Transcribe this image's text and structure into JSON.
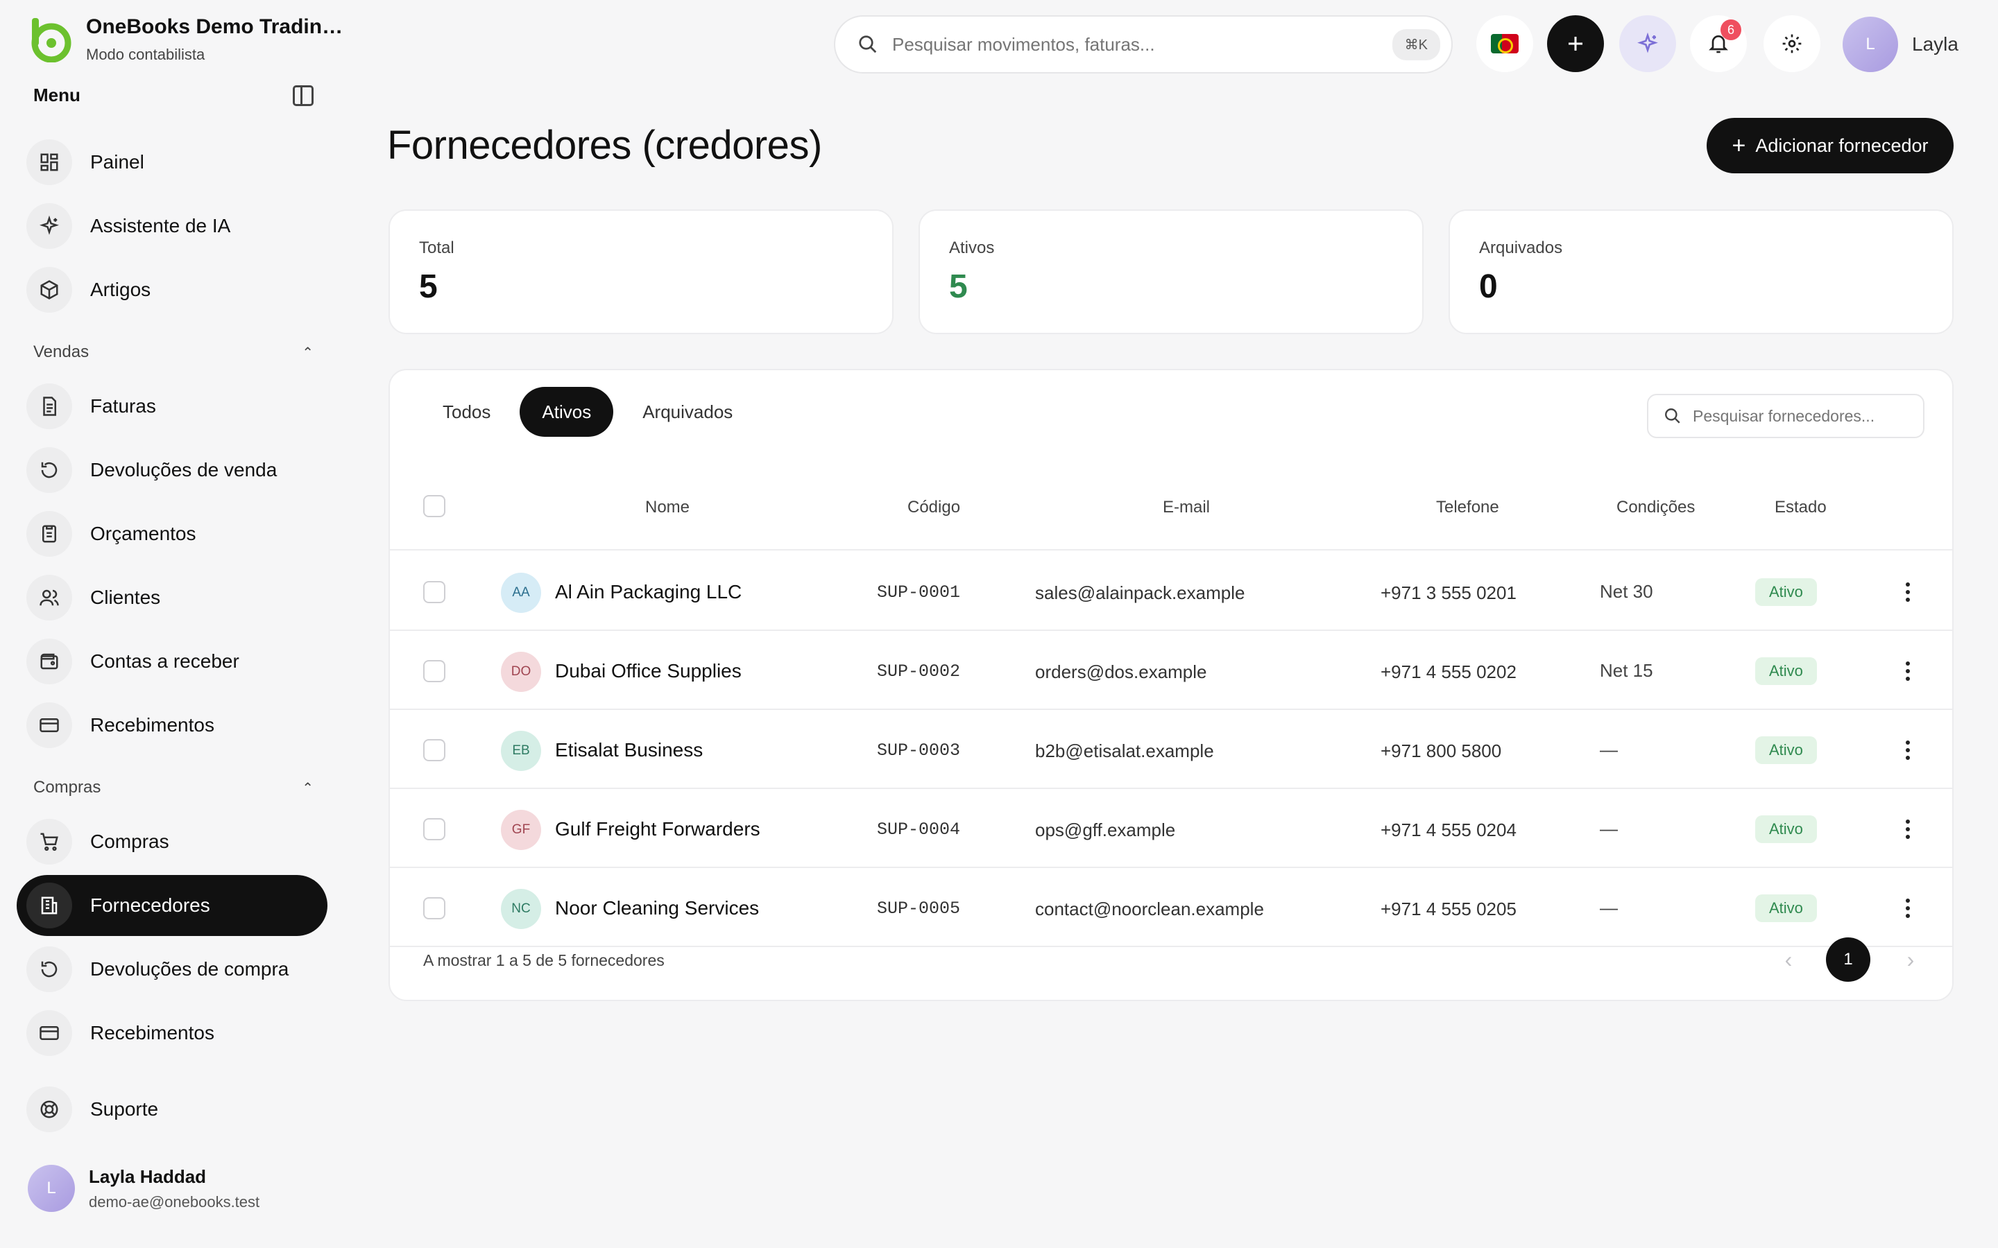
{
  "brand": {
    "name": "OneBooks Demo Tradin…",
    "subtitle": "Modo contabilista"
  },
  "menu": {
    "title": "Menu"
  },
  "sidebar": {
    "top_items": [
      {
        "label": "Painel",
        "icon": "dashboard-icon"
      },
      {
        "label": "Assistente de IA",
        "icon": "sparkles-icon"
      },
      {
        "label": "Artigos",
        "icon": "package-icon"
      }
    ],
    "sales": {
      "title": "Vendas",
      "items": [
        {
          "label": "Faturas",
          "icon": "invoice-icon"
        },
        {
          "label": "Devoluções de venda",
          "icon": "return-icon"
        },
        {
          "label": "Orçamentos",
          "icon": "quote-icon"
        },
        {
          "label": "Clientes",
          "icon": "users-icon"
        },
        {
          "label": "Contas a receber",
          "icon": "wallet-icon"
        },
        {
          "label": "Recebimentos",
          "icon": "card-icon"
        }
      ]
    },
    "purchases": {
      "title": "Compras",
      "items": [
        {
          "label": "Compras",
          "icon": "cart-icon"
        },
        {
          "label": "Fornecedores",
          "icon": "building-icon",
          "active": true
        },
        {
          "label": "Devoluções de compra",
          "icon": "return-icon"
        },
        {
          "label": "Recebimentos",
          "icon": "card-icon"
        }
      ]
    },
    "support": {
      "label": "Suporte",
      "icon": "lifebuoy-icon"
    }
  },
  "user": {
    "initial": "L",
    "name": "Layla Haddad",
    "email": "demo-ae@onebooks.test",
    "short_name": "Layla"
  },
  "topbar": {
    "search_placeholder": "Pesquisar movimentos, faturas...",
    "shortcut": "⌘K",
    "notifications_count": "6"
  },
  "page": {
    "title": "Fornecedores (credores)",
    "add_button": "Adicionar fornecedor"
  },
  "stats": {
    "total": {
      "label": "Total",
      "value": "5"
    },
    "active": {
      "label": "Ativos",
      "value": "5"
    },
    "archived": {
      "label": "Arquivados",
      "value": "0"
    }
  },
  "tabs": {
    "all": "Todos",
    "active": "Ativos",
    "archived": "Arquivados"
  },
  "table_search_placeholder": "Pesquisar fornecedores...",
  "columns": {
    "name": "Nome",
    "code": "Código",
    "email": "E-mail",
    "phone": "Telefone",
    "terms": "Condições",
    "status": "Estado"
  },
  "suppliers": [
    {
      "initials": "AA",
      "name": "Al Ain Packaging LLC",
      "code": "SUP-0001",
      "email": "sales@alainpack.example",
      "phone": "+971 3 555 0201",
      "terms": "Net 30",
      "status": "Ativo",
      "avatar_bg": "#d6ecf6",
      "avatar_fg": "#2c6f8e"
    },
    {
      "initials": "DO",
      "name": "Dubai Office Supplies",
      "code": "SUP-0002",
      "email": "orders@dos.example",
      "phone": "+971 4 555 0202",
      "terms": "Net 15",
      "status": "Ativo",
      "avatar_bg": "#f4d9dc",
      "avatar_fg": "#a04551"
    },
    {
      "initials": "EB",
      "name": "Etisalat Business",
      "code": "SUP-0003",
      "email": "b2b@etisalat.example",
      "phone": "+971 800 5800",
      "terms": "—",
      "status": "Ativo",
      "avatar_bg": "#d5eee6",
      "avatar_fg": "#2e7b63"
    },
    {
      "initials": "GF",
      "name": "Gulf Freight Forwarders",
      "code": "SUP-0004",
      "email": "ops@gff.example",
      "phone": "+971 4 555 0204",
      "terms": "—",
      "status": "Ativo",
      "avatar_bg": "#f4d9dc",
      "avatar_fg": "#a04551"
    },
    {
      "initials": "NC",
      "name": "Noor Cleaning Services",
      "code": "SUP-0005",
      "email": "contact@noorclean.example",
      "phone": "+971 4 555 0205",
      "terms": "—",
      "status": "Ativo",
      "avatar_bg": "#d5eee6",
      "avatar_fg": "#2e7b63"
    }
  ],
  "footer": {
    "summary": "A mostrar 1 a 5 de 5 fornecedores",
    "current_page": "1"
  }
}
